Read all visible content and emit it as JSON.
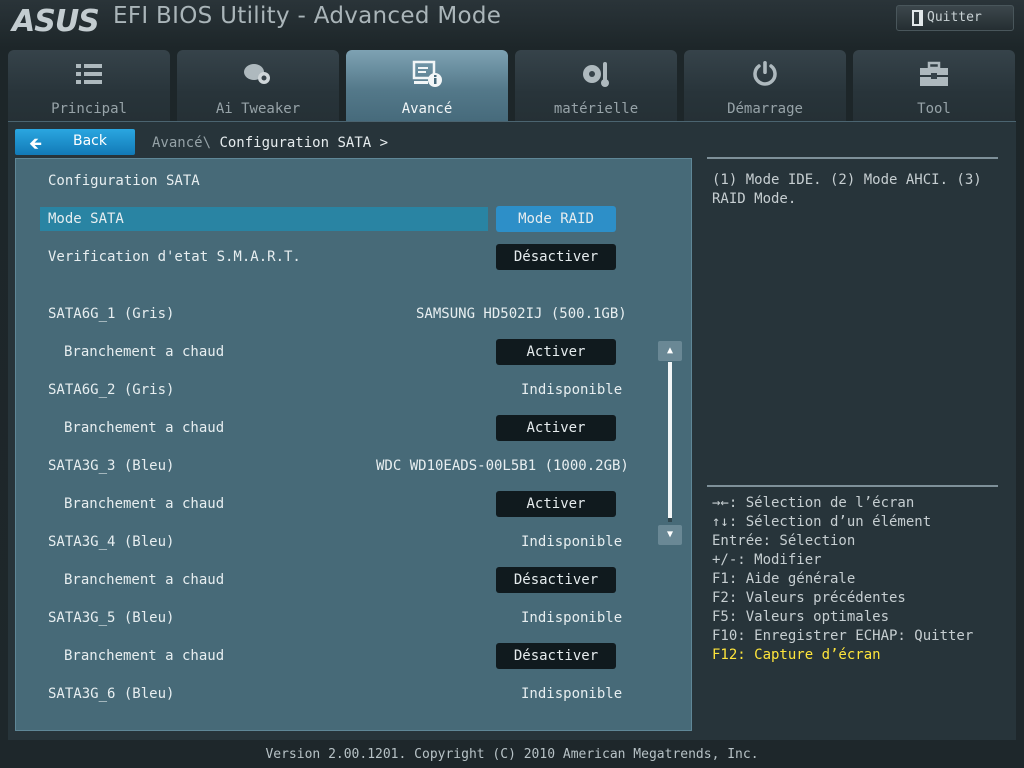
{
  "header": {
    "logo": "ASUS",
    "title": "EFI BIOS Utility - Advanced Mode",
    "exit_label": "Quitter"
  },
  "tabs": [
    {
      "label": "Principal",
      "icon": "list-icon",
      "active": false
    },
    {
      "label": "Ai Tweaker",
      "icon": "ai-tweaker-icon",
      "active": false
    },
    {
      "label": "Avancé",
      "icon": "advanced-icon",
      "active": true
    },
    {
      "label": "matérielle",
      "icon": "monitor-gauge-icon",
      "active": false
    },
    {
      "label": "Démarrage",
      "icon": "power-icon",
      "active": false
    },
    {
      "label": "Tool",
      "icon": "toolbox-icon",
      "active": false
    }
  ],
  "nav": {
    "back_label": "Back",
    "breadcrumb_parent": "Avancé\\",
    "breadcrumb_current": "Configuration SATA >"
  },
  "settings": {
    "section_title": "Configuration SATA",
    "rows": [
      {
        "label": "Mode SATA",
        "value": "Mode RAID"
      },
      {
        "label": "Verification d'etat S.M.A.R.T.",
        "value": "Désactiver"
      },
      {
        "label": "SATA6G_1 (Gris)",
        "value": "SAMSUNG HD502IJ (500.1GB)"
      },
      {
        "label": "Branchement a chaud",
        "value": "Activer"
      },
      {
        "label": "SATA6G_2 (Gris)",
        "value": "Indisponible"
      },
      {
        "label": "Branchement a chaud",
        "value": "Activer"
      },
      {
        "label": "SATA3G_3 (Bleu)",
        "value": "WDC WD10EADS-00L5B1 (1000.2GB)"
      },
      {
        "label": "Branchement a chaud",
        "value": "Activer"
      },
      {
        "label": "SATA3G_4 (Bleu)",
        "value": "Indisponible"
      },
      {
        "label": "Branchement a chaud",
        "value": "Désactiver"
      },
      {
        "label": "SATA3G_5 (Bleu)",
        "value": "Indisponible"
      },
      {
        "label": "Branchement a chaud",
        "value": "Désactiver"
      },
      {
        "label": "SATA3G_6 (Bleu)",
        "value": "Indisponible"
      }
    ]
  },
  "help": {
    "text": "(1) Mode IDE. (2) Mode AHCI. (3) RAID Mode.",
    "keys": [
      "→←: Sélection de l’écran",
      "↑↓: Sélection d’un élément",
      "Entrée: Sélection",
      "+/-: Modifier",
      "F1: Aide générale",
      "F2: Valeurs précédentes",
      "F5: Valeurs optimales",
      "F10: Enregistrer  ECHAP: Quitter",
      "F12: Capture d’écran"
    ]
  },
  "footer": "Version 2.00.1201. Copyright (C) 2010 American Megatrends, Inc.",
  "colors": {
    "accent": "#2d8fc8",
    "highlight_key": "#ffe53b",
    "panel": "#476a78"
  }
}
